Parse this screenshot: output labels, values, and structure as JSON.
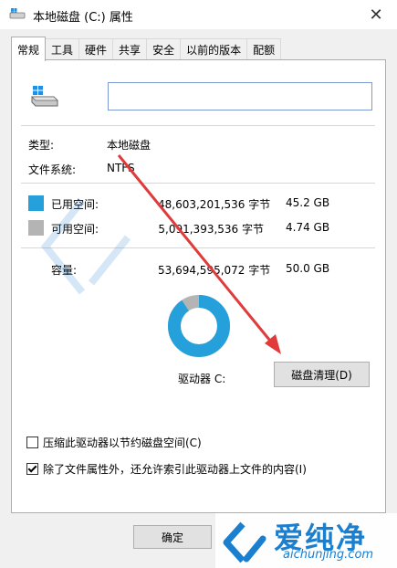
{
  "window": {
    "title": "本地磁盘 (C:) 属性",
    "close_glyph": "✕"
  },
  "tabs": [
    {
      "label": "常规",
      "active": true
    },
    {
      "label": "工具",
      "active": false
    },
    {
      "label": "硬件",
      "active": false
    },
    {
      "label": "共享",
      "active": false
    },
    {
      "label": "安全",
      "active": false
    },
    {
      "label": "以前的版本",
      "active": false
    },
    {
      "label": "配额",
      "active": false
    }
  ],
  "general": {
    "name_value": "",
    "type_label": "类型:",
    "type_value": "本地磁盘",
    "fs_label": "文件系统:",
    "fs_value": "NTFS",
    "used": {
      "label": "已用空间:",
      "bytes": "48,603,201,536 字节",
      "size": "45.2 GB",
      "color": "#26a0da"
    },
    "free": {
      "label": "可用空间:",
      "bytes": "5,091,393,536 字节",
      "size": "4.74 GB",
      "color": "#b4b4b4"
    },
    "capacity": {
      "label": "容量:",
      "bytes": "53,694,595,072 字节",
      "size": "50.0 GB"
    },
    "used_fraction": 0.905,
    "drive_label": "驱动器 C:",
    "cleanup_button": "磁盘清理(D)",
    "compress_label": "压缩此驱动器以节约磁盘空间(C)",
    "compress_checked": false,
    "index_label": "除了文件属性外，还允许索引此驱动器上文件的内容(I)",
    "index_checked": true
  },
  "footer": {
    "ok_button": "确定"
  },
  "watermark": {
    "title": "爱纯净",
    "url": "aichunjing.com",
    "color": "#1b7fcf"
  }
}
